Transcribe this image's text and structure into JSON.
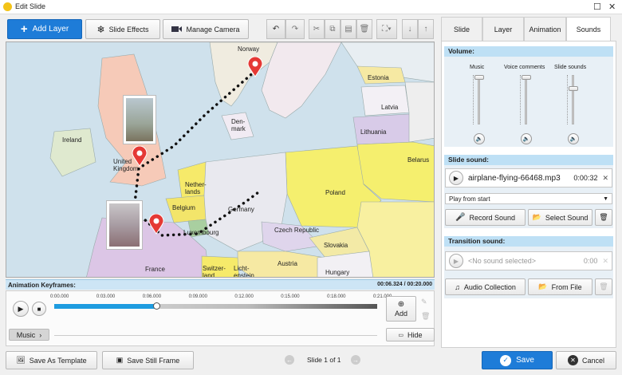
{
  "window": {
    "title": "Edit Slide",
    "maximize_glyph": "☐",
    "close_glyph": "✕"
  },
  "toolbar": {
    "add_layer": "Add Layer",
    "slide_effects": "Slide Effects",
    "manage_camera": "Manage Camera"
  },
  "map": {
    "labels": {
      "norway": "Norway",
      "estonia": "Estonia",
      "latvia": "Latvia",
      "denmark": "Den-\nmark",
      "lithuania": "Lithuania",
      "ireland": "Ireland",
      "uk": "United\nKingdom",
      "belarus": "Belarus",
      "netherlands": "Nether-\nlands",
      "poland": "Poland",
      "belgium": "Belgium",
      "germany": "Germany",
      "luxembourg": "Luxembourg",
      "czech": "Czech Republic",
      "slovakia": "Slovakia",
      "austria": "Austria",
      "france": "France",
      "switzerland": "Switzer-\nland",
      "liechtenstein": "Licht-\nenstein",
      "hungary": "Hungary"
    }
  },
  "keyframes": {
    "label": "Animation Keyframes:",
    "time": "00:06.324 / 00:20.000",
    "progress_fraction": 0.316
  },
  "timeline": {
    "ticks": [
      "0:00.000",
      "0:03.000",
      "0:06.000",
      "0:09.000",
      "0:12.000",
      "0:15.000",
      "0:18.000",
      "0:21.000"
    ],
    "add_label": "Add",
    "music_label": "Music",
    "hide_label": "Hide"
  },
  "tabs": [
    "Slide",
    "Layer",
    "Animation",
    "Sounds"
  ],
  "sounds": {
    "volume_header": "Volume:",
    "volume_columns": [
      {
        "label": "Music",
        "level_fraction": 1.0
      },
      {
        "label": "Voice comments",
        "level_fraction": 1.0
      },
      {
        "label": "Slide sounds",
        "level_fraction": 0.75
      }
    ],
    "slide_sound_header": "Slide sound:",
    "slide_sound_file": "airplane-flying-66468.mp3",
    "slide_sound_duration": "0:00:32",
    "play_mode": "Play from start",
    "record_sound": "Record Sound",
    "select_sound": "Select Sound",
    "transition_header": "Transition sound:",
    "transition_placeholder": "<No sound selected>",
    "transition_duration": "0:00",
    "audio_collection": "Audio Collection",
    "from_file": "From File"
  },
  "bottom": {
    "save_as_template": "Save As Template",
    "save_still_frame": "Save Still Frame",
    "slide_counter": "Slide 1 of 1",
    "save": "Save",
    "cancel": "Cancel"
  },
  "colors": {
    "accent": "#1e7cd8",
    "header": "#bee0f5",
    "timeline_fill": "#1e9ce0"
  }
}
